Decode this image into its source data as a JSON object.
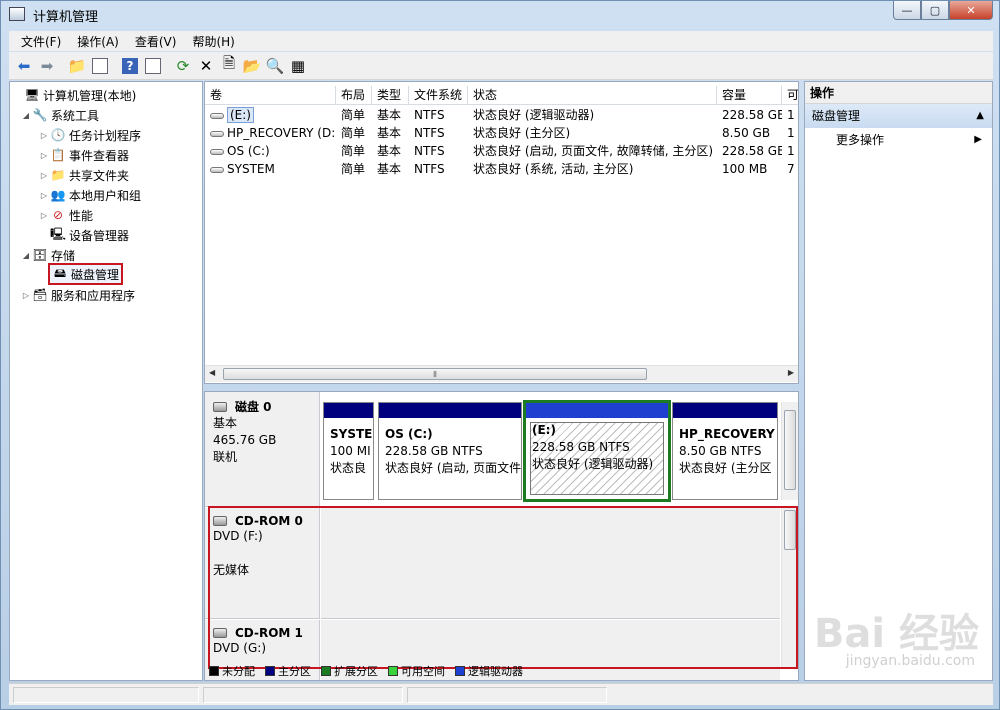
{
  "window": {
    "title": "计算机管理"
  },
  "menu": [
    "文件(F)",
    "操作(A)",
    "查看(V)",
    "帮助(H)"
  ],
  "tree": [
    {
      "label": "计算机管理(本地)",
      "icon": "computer-icon",
      "level": 0,
      "twisty": ""
    },
    {
      "label": "系统工具",
      "icon": "tools-icon",
      "level": 1,
      "twisty": "▲"
    },
    {
      "label": "任务计划程序",
      "icon": "clock-icon",
      "level": 2,
      "twisty": "▷"
    },
    {
      "label": "事件查看器",
      "icon": "event-viewer-icon",
      "level": 2,
      "twisty": "▷"
    },
    {
      "label": "共享文件夹",
      "icon": "shared-folder-icon",
      "level": 2,
      "twisty": "▷"
    },
    {
      "label": "本地用户和组",
      "icon": "users-icon",
      "level": 2,
      "twisty": "▷"
    },
    {
      "label": "性能",
      "icon": "performance-icon",
      "level": 2,
      "twisty": "▷"
    },
    {
      "label": "设备管理器",
      "icon": "device-manager-icon",
      "level": 2,
      "twisty": ""
    },
    {
      "label": "存储",
      "icon": "storage-icon",
      "level": 1,
      "twisty": "◢"
    },
    {
      "label": "磁盘管理",
      "icon": "disk-management-icon",
      "level": 2,
      "twisty": ""
    },
    {
      "label": "服务和应用程序",
      "icon": "services-icon",
      "level": 1,
      "twisty": "▷"
    }
  ],
  "volume_table": {
    "columns": [
      "卷",
      "布局",
      "类型",
      "文件系统",
      "状态",
      "容量",
      "可"
    ],
    "rows": [
      [
        "(E:)",
        "简单",
        "基本",
        "NTFS",
        "状态良好 (逻辑驱动器)",
        "228.58 GB",
        "1"
      ],
      [
        "HP_RECOVERY (D:)",
        "简单",
        "基本",
        "NTFS",
        "状态良好 (主分区)",
        "8.50 GB",
        "1"
      ],
      [
        "OS (C:)",
        "简单",
        "基本",
        "NTFS",
        "状态良好 (启动, 页面文件, 故障转储, 主分区)",
        "228.58 GB",
        "1"
      ],
      [
        "SYSTEM",
        "简单",
        "基本",
        "NTFS",
        "状态良好 (系统, 活动, 主分区)",
        "100 MB",
        "7"
      ]
    ]
  },
  "disks": {
    "disk0": {
      "name": "磁盘 0",
      "lines": [
        "基本",
        "465.76 GB",
        "联机"
      ],
      "partitions": [
        {
          "name": "SYSTE",
          "size": "100 MI",
          "status": "状态良"
        },
        {
          "name": "OS  (C:)",
          "size": "228.58 GB NTFS",
          "status": "状态良好 (启动, 页面文件"
        },
        {
          "name": "(E:)",
          "size": "228.58 GB NTFS",
          "status": "状态良好 (逻辑驱动器)"
        },
        {
          "name": "HP_RECOVERY",
          "size": "8.50 GB NTFS",
          "status": "状态良好 (主分区"
        }
      ]
    },
    "cdrom0": {
      "name": "CD-ROM 0",
      "line1": "DVD (F:)",
      "line2": "无媒体"
    },
    "cdrom1": {
      "name": "CD-ROM 1",
      "line1": "DVD (G:)"
    }
  },
  "legend": [
    {
      "label": "未分配",
      "color": "#000000"
    },
    {
      "label": "主分区",
      "color": "#00007f"
    },
    {
      "label": "扩展分区",
      "color": "#1b7a22"
    },
    {
      "label": "可用空间",
      "color": "#3ad13a"
    },
    {
      "label": "逻辑驱动器",
      "color": "#1e3fd0"
    }
  ],
  "actions": {
    "header": "操作",
    "section": "磁盘管理",
    "item": "更多操作"
  },
  "watermark": {
    "brand": "Bai 经验",
    "url": "jingyan.baidu.com"
  }
}
